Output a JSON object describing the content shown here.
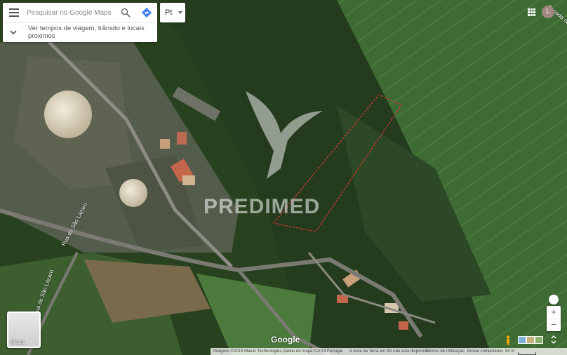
{
  "search": {
    "placeholder": "Pesquisar no Google Maps",
    "suggestion": "Ver tempos de viagem, trânsito e locais próximos"
  },
  "language": {
    "selected": "Pt"
  },
  "account": {
    "initial": "L"
  },
  "watermark": {
    "text": "PREDIMED"
  },
  "roads": {
    "label_1": "Rua de São Lázaro",
    "label_2": "Rua de São Lázaro",
    "label_3": "Canada do Jacinto"
  },
  "layer_toggle": {
    "label": "Mapa"
  },
  "logo": {
    "text": "Google"
  },
  "footer": {
    "imagery": "Imagens ©2019 Maxar Technologies,Dados do mapa ©2019",
    "country": "Portugal",
    "notice": "A vista da Terra em 3D não está disponível",
    "terms": "Termos de Utilização",
    "feedback": "Enviar comentários",
    "scale": "50 m"
  },
  "zoom": {
    "in_label": "+",
    "out_label": "−"
  },
  "colors": {
    "forest": "#2f4a2a",
    "field": "#3f6b33",
    "road": "#7a7a72",
    "property_line": "#c0392b"
  },
  "icons": [
    "menu-icon",
    "search-icon",
    "directions-icon",
    "chevron-down-icon",
    "apps-icon",
    "pegman-icon",
    "compass-icon",
    "expand-icon"
  ]
}
